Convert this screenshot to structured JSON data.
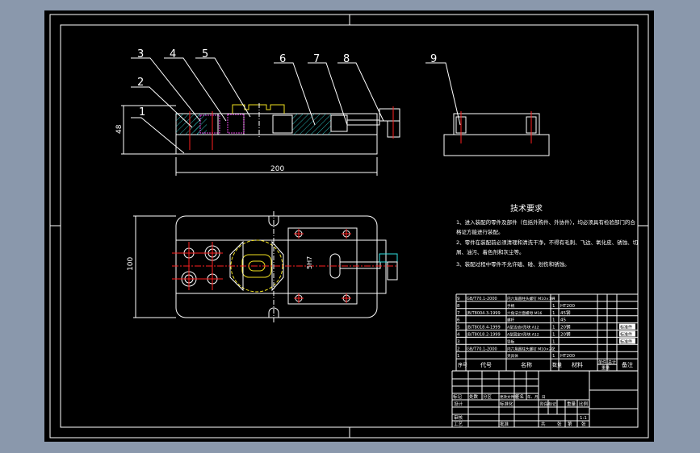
{
  "colors": {
    "background": "#8a98ac",
    "sheet": "#000000",
    "lines": "#ffffff",
    "centerlines": "#ff2020",
    "highlight": "#f0e020",
    "hidden": "#e040e0",
    "hatch_section": "#30e0e0"
  },
  "balloons": [
    "1",
    "2",
    "3",
    "4",
    "5",
    "6",
    "7",
    "8",
    "9"
  ],
  "dimensions": {
    "length": "200",
    "height": "48",
    "width": "100",
    "top_view_note": "5H7"
  },
  "tech_requirements": {
    "title": "技术要求",
    "lines": [
      "1、进入装配的零件及部件（包括外购件、外协件），均必须具有检验部门的合",
      "格证方能进行装配。",
      "2、零件在装配前必须清理和清洗干净，不得有毛刺、飞边、氧化皮、锈蚀、切",
      "屑、油污、着色剂和灰尘等。",
      "3、装配过程中零件不允许磕、碰、划伤和锈蚀。"
    ]
  },
  "parts_list": {
    "rows": [
      {
        "no": "9",
        "code": "GB/T70.1-2000",
        "name": "内六角圆柱头螺钉 M10×16",
        "qty": "4",
        "material": ""
      },
      {
        "no": "8",
        "code": "",
        "name": "手柄",
        "qty": "1",
        "material": "HT200"
      },
      {
        "no": "7",
        "code": "JB/T8004.3-1999",
        "name": "六角法兰面螺母 M16",
        "qty": "1",
        "material": "45钢"
      },
      {
        "no": "6",
        "code": "",
        "name": "螺杆",
        "qty": "1",
        "material": "45"
      },
      {
        "no": "5",
        "code": "JB/T8018.4-1999",
        "name": "A型活动V形块 A12",
        "qty": "1",
        "material": "20钢"
      },
      {
        "no": "4",
        "code": "JB/T8018.2-1999",
        "name": "A型固定V形块 A12",
        "qty": "1",
        "material": "20钢"
      },
      {
        "no": "3",
        "code": "",
        "name": "导板",
        "qty": "1",
        "material": ""
      },
      {
        "no": "2",
        "code": "GB/T70.1-2000",
        "name": "内六角圆柱头螺钉 M10×20",
        "qty": "2",
        "material": ""
      },
      {
        "no": "1",
        "code": "",
        "name": "夹具体",
        "qty": "1",
        "material": "HT200"
      }
    ],
    "remarks": [
      "标准件",
      "标准件",
      "标准件"
    ],
    "header": {
      "no": "序号",
      "code": "代号",
      "name": "名称",
      "qty": "数量",
      "material": "材料",
      "single": "单件",
      "total": "总计",
      "weight": "重量",
      "remark": "备注"
    }
  },
  "title_block": {
    "revision_labels": [
      "标记",
      "处数",
      "分区",
      "更改文件号",
      "签名",
      "年、月、日"
    ],
    "design": "设计",
    "standardization": "标准化",
    "review": "审核",
    "process": "工艺",
    "approve": "批准",
    "stage_labels": [
      "阶段标记",
      "重量",
      "比例"
    ],
    "scale": "1:1",
    "sheet_labels": [
      "共",
      "张",
      "第",
      "张"
    ]
  }
}
